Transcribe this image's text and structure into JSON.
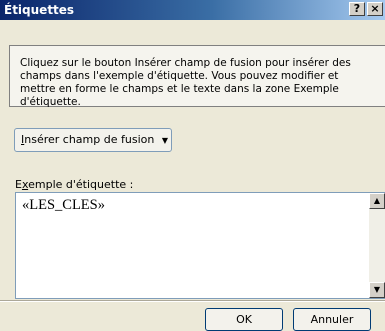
{
  "window": {
    "title": "Étiquettes",
    "help_label": "?",
    "close_label": "×"
  },
  "info": {
    "text": "Cliquez sur le bouton Insérer champ de fusion pour insérer des champs dans l'exemple d'étiquette. Vous pouvez modifier et mettre en forme le champs et  le texte dans la zone Exemple d'étiquette."
  },
  "insert_button": {
    "accel": "I",
    "rest": "nsérer champ de fusion",
    "caret": "▼"
  },
  "example": {
    "label_pre": "E",
    "label_accel": "x",
    "label_post": "emple d'étiquette :",
    "content": "«LES_CLES»"
  },
  "scrollbar": {
    "up": "▲",
    "down": "▼"
  },
  "buttons": {
    "ok": "OK",
    "cancel": "Annuler"
  }
}
